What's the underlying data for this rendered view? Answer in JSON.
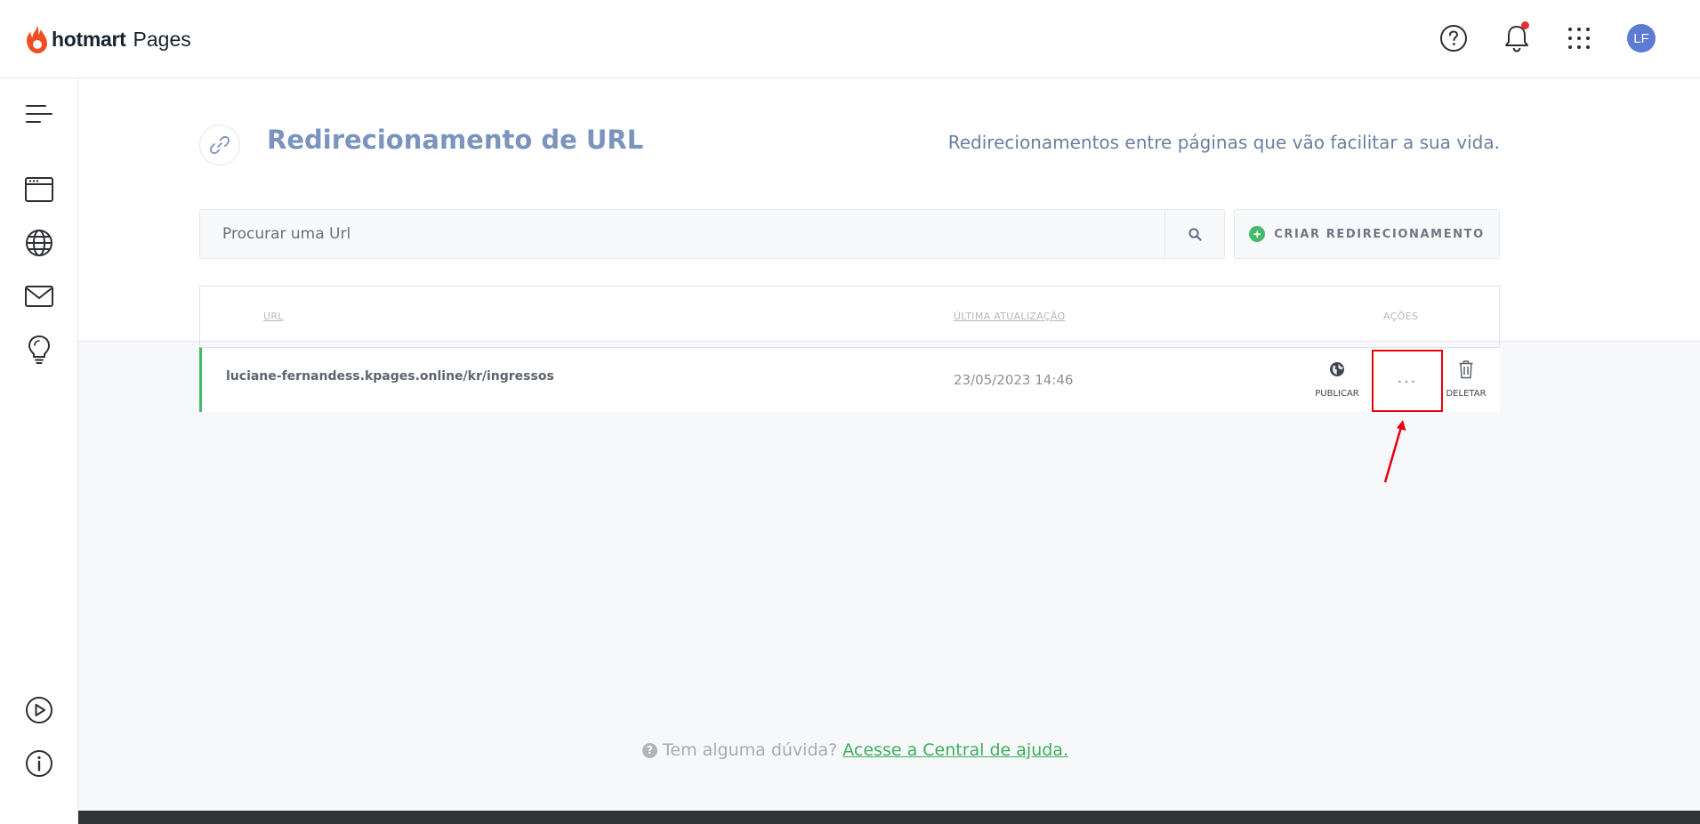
{
  "header": {
    "brand": "hotmart",
    "product": "Pages",
    "avatar_initials": "LF",
    "icons": [
      "help-circle-icon",
      "bell-icon",
      "apps-grid-icon"
    ]
  },
  "sidebar": {
    "icons": [
      "menu-icon",
      "browser-window-icon",
      "globe-icon",
      "mail-icon",
      "lightbulb-icon",
      "play-circle-icon",
      "info-circle-icon"
    ]
  },
  "page": {
    "title": "Redirecionamento de URL",
    "subtitle": "Redirecionamentos entre páginas que vão facilitar a sua vida.",
    "icon": "link-icon"
  },
  "search": {
    "placeholder": "Procurar uma Url"
  },
  "create_button": {
    "label": "CRIAR REDIRECIONAMENTO"
  },
  "table": {
    "headers": {
      "url": "URL",
      "updated": "ÚLTIMA ATUALIZAÇÃO",
      "actions": "AÇÕES"
    },
    "rows": [
      {
        "url": "luciane-fernandess.kpages.online/kr/ingressos",
        "updated": "23/05/2023 14:46",
        "publish_label": "PUBLICAR",
        "more_label": "...",
        "delete_label": "DELETAR"
      }
    ]
  },
  "help": {
    "question": "Tem alguma dúvida?",
    "link": "Acesse a Central de ajuda."
  },
  "colors": {
    "accent_green": "#46b96a",
    "title_blue": "#7a94bd",
    "highlight_red": "#e8000a",
    "avatar_blue": "#5b7bd5",
    "logo_orange": "#f04e23"
  }
}
